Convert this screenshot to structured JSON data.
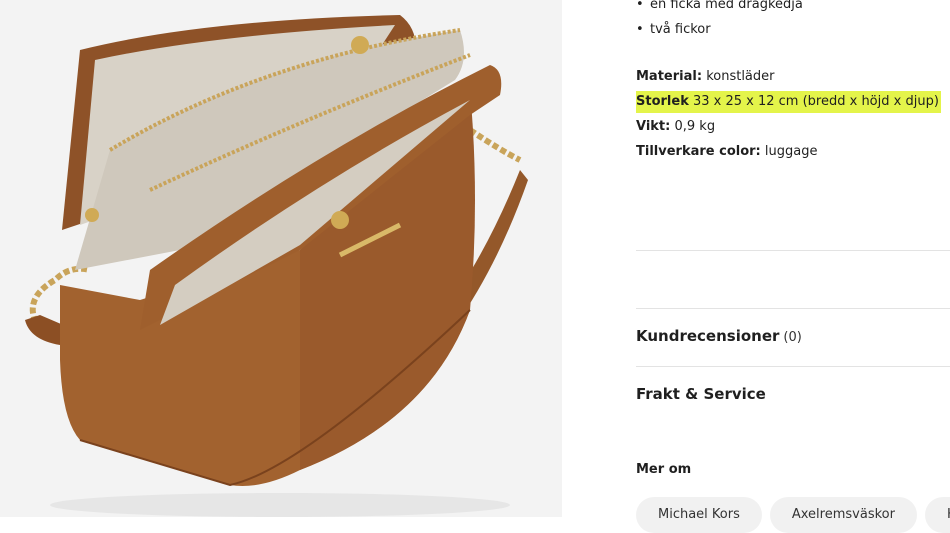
{
  "features": [
    "en ficka med dragkedja",
    "två fickor"
  ],
  "specs": {
    "material": {
      "label": "Material:",
      "value": "konstläder"
    },
    "size": {
      "label": "Storlek",
      "value": "33 x 25 x 12 cm (bredd x höjd x djup)"
    },
    "weight": {
      "label": "Vikt:",
      "value": "0,9 kg"
    },
    "color": {
      "label": "Tillverkare color:",
      "value": "luggage"
    }
  },
  "colors": {
    "highlight": "#e4f44a",
    "leather": "#9a5a2c",
    "gold": "#c9a45a"
  },
  "accordions": {
    "reviews": {
      "label": "Kundrecensioner",
      "count": "(0)"
    },
    "shipping": {
      "label": "Frakt & Service"
    }
  },
  "more": {
    "title": "Mer om",
    "chips": [
      "Michael Kors",
      "Axelremsväskor",
      "Ha"
    ]
  },
  "product_image": {
    "alt": "handbag-photo"
  }
}
